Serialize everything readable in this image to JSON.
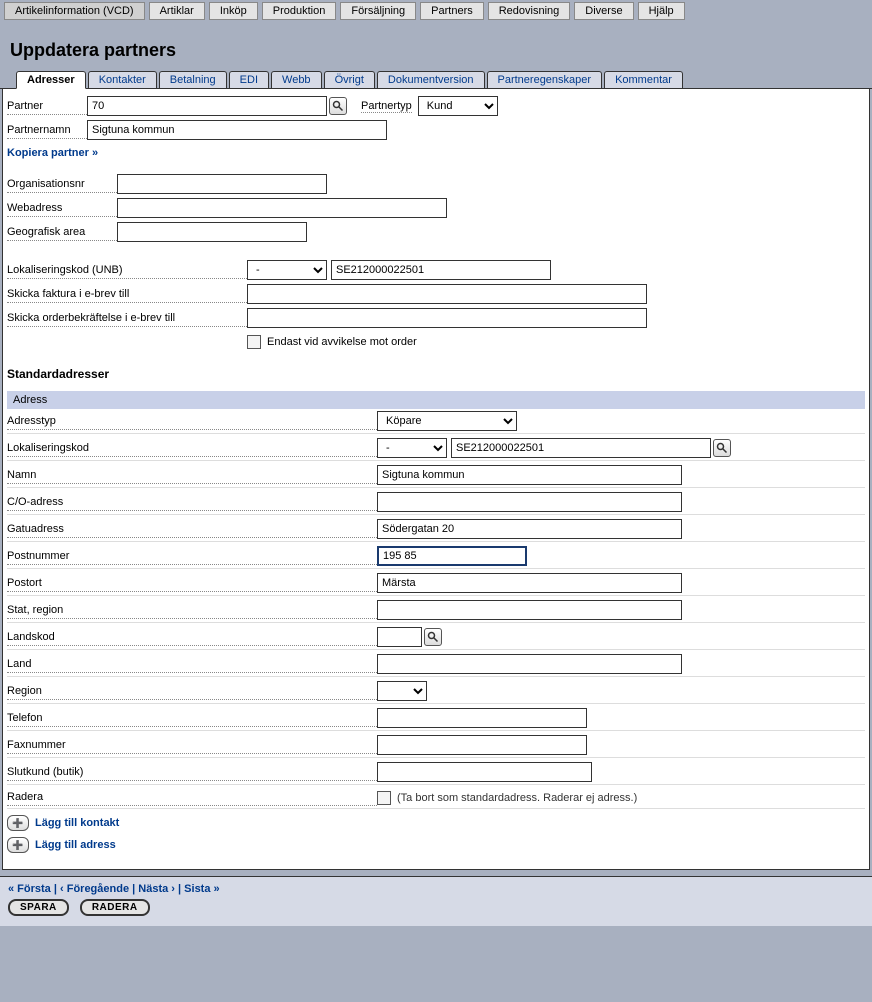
{
  "topmenu": [
    {
      "label": "Artikelinformation (VCD)",
      "active": true
    },
    {
      "label": "Artiklar"
    },
    {
      "label": "Inköp"
    },
    {
      "label": "Produktion"
    },
    {
      "label": "Försäljning"
    },
    {
      "label": "Partners"
    },
    {
      "label": "Redovisning"
    },
    {
      "label": "Diverse"
    },
    {
      "label": "Hjälp"
    }
  ],
  "page_title": "Uppdatera partners",
  "tabs": [
    {
      "label": "Adresser",
      "active": true
    },
    {
      "label": "Kontakter"
    },
    {
      "label": "Betalning"
    },
    {
      "label": "EDI"
    },
    {
      "label": "Webb"
    },
    {
      "label": "Övrigt"
    },
    {
      "label": "Dokumentversion"
    },
    {
      "label": "Partneregenskaper"
    },
    {
      "label": "Kommentar"
    }
  ],
  "fields": {
    "partner_label": "Partner",
    "partner_value": "70",
    "partnertyp_label": "Partnertyp",
    "partnertyp_value": "Kund",
    "partnernamn_label": "Partnernamn",
    "partnernamn_value": "Sigtuna kommun",
    "kopiera_link": "Kopiera partner »",
    "orgnr_label": "Organisationsnr",
    "orgnr_value": "",
    "web_label": "Webadress",
    "web_value": "",
    "geo_label": "Geografisk area",
    "geo_value": "",
    "unb_label": "Lokaliseringskod (UNB)",
    "unb_select": "-",
    "unb_value": "SE212000022501",
    "faktura_label": "Skicka faktura i e-brev till",
    "faktura_value": "",
    "orderbek_label": "Skicka orderbekräftelse i e-brev till",
    "orderbek_value": "",
    "endast_label": "Endast vid avvikelse mot order"
  },
  "section_title": "Standardadresser",
  "addr": {
    "head": "Adress",
    "adresstyp_label": "Adresstyp",
    "adresstyp_value": "Köpare",
    "lok_label": "Lokaliseringskod",
    "lok_select": "-",
    "lok_value": "SE212000022501",
    "namn_label": "Namn",
    "namn_value": "Sigtuna kommun",
    "co_label": "C/O-adress",
    "co_value": "",
    "gata_label": "Gatuadress",
    "gata_value": "Södergatan 20",
    "postnr_label": "Postnummer",
    "postnr_value": "195 85",
    "postort_label": "Postort",
    "postort_value": "Märsta",
    "stat_label": "Stat, region",
    "stat_value": "",
    "landkod_label": "Landskod",
    "landkod_value": "",
    "land_label": "Land",
    "land_value": "",
    "region_label": "Region",
    "region_value": "",
    "telefon_label": "Telefon",
    "telefon_value": "",
    "fax_label": "Faxnummer",
    "fax_value": "",
    "slutkund_label": "Slutkund (butik)",
    "slutkund_value": "",
    "radera_label": "Radera",
    "radera_note": "(Ta bort som standardadress. Raderar ej adress.)"
  },
  "add_links": {
    "kontakt": "Lägg till kontakt",
    "adress": "Lägg till adress"
  },
  "footer": {
    "first": "« Första",
    "prev": "‹ Föregående",
    "next": "Nästa ›",
    "last": "Sista »",
    "sep": " | ",
    "save": "SPARA",
    "delete": "RADERA"
  }
}
